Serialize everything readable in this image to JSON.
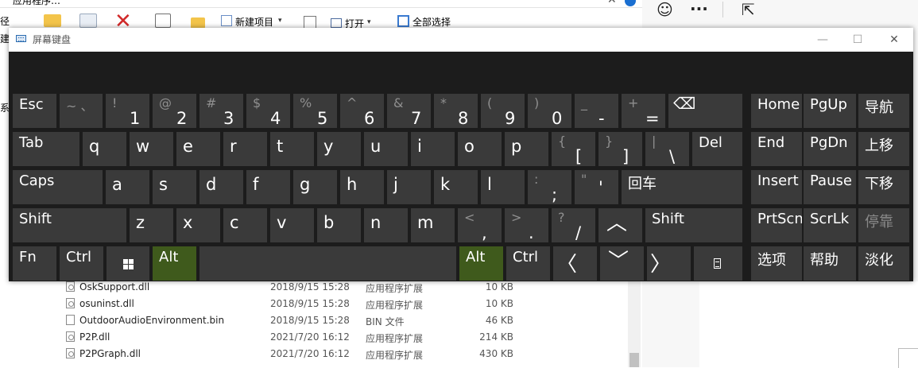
{
  "explorer": {
    "title_fragment": "应用程序…",
    "side_fragments": [
      "径",
      "建",
      "系"
    ],
    "ribbon": {
      "new_item": "新建项目",
      "open": "打开",
      "select_all": "全部选择"
    },
    "files": [
      {
        "name": "OskSupport.dll",
        "date": "2018/9/15 15:28",
        "type": "应用程序扩展",
        "size": "10 KB",
        "icon": "dll-icon"
      },
      {
        "name": "osuninst.dll",
        "date": "2018/9/15 15:28",
        "type": "应用程序扩展",
        "size": "10 KB",
        "icon": "dll-icon"
      },
      {
        "name": "OutdoorAudioEnvironment.bin",
        "date": "2018/9/15 15:28",
        "type": "BIN 文件",
        "size": "46 KB",
        "icon": "file-icon"
      },
      {
        "name": "P2P.dll",
        "date": "2021/7/20 16:12",
        "type": "应用程序扩展",
        "size": "214 KB",
        "icon": "dll-icon"
      },
      {
        "name": "P2PGraph.dll",
        "date": "2021/7/20 16:12",
        "type": "应用程序扩展",
        "size": "430 KB",
        "icon": "dll-icon"
      }
    ]
  },
  "right_toolbar": {
    "emoji_icon": "☺",
    "more_icon": "···",
    "share_icon": "⇱"
  },
  "osk": {
    "title": "屏幕键盘",
    "window_controls": {
      "minimize": "—",
      "maximize": "☐",
      "close": "✕"
    },
    "colors": {
      "key": "#3a3a3a",
      "active_key": "#3f5a1c",
      "body": "#1c1c1c"
    },
    "keys": {
      "esc": "Esc",
      "n1": {
        "up": "! ",
        "down": "1"
      },
      "tilde": {
        "up": "~ 、",
        "down": ""
      },
      "n2": {
        "up": "@",
        "down": "2"
      },
      "n3": {
        "up": "#",
        "down": "3"
      },
      "n4": {
        "up": "$",
        "down": "4"
      },
      "n5": {
        "up": "%",
        "down": "5"
      },
      "n6": {
        "up": "^",
        "down": "6"
      },
      "n7": {
        "up": "&",
        "down": "7"
      },
      "n8": {
        "up": "*",
        "down": "8"
      },
      "n9": {
        "up": "(",
        "down": "9"
      },
      "n0": {
        "up": ")",
        "down": "0"
      },
      "minus": {
        "up": "_",
        "down": "-"
      },
      "equals": {
        "up": "+",
        "down": "="
      },
      "backspace": "⌫",
      "home": "Home",
      "pgup": "PgUp",
      "nav": "导航",
      "tab": "Tab",
      "q": "q",
      "w": "w",
      "e": "e",
      "r": "r",
      "t": "t",
      "y": "y",
      "u": "u",
      "i": "i",
      "o": "o",
      "p": "p",
      "lbracket": {
        "up": "{",
        "down": "["
      },
      "rbracket": {
        "up": "}",
        "down": "]"
      },
      "backslash": {
        "up": "|",
        "down": "\\"
      },
      "del": "Del",
      "end": "End",
      "pgdn": "PgDn",
      "move_up": "上移",
      "caps": "Caps",
      "a": "a",
      "s": "s",
      "d": "d",
      "f": "f",
      "g": "g",
      "h": "h",
      "j": "j",
      "k": "k",
      "l": "l",
      "semicolon": {
        "up": ":",
        "down": ";"
      },
      "quote": {
        "up": "\"",
        "down": "'"
      },
      "enter": "回车",
      "insert": "Insert",
      "pause": "Pause",
      "move_down": "下移",
      "shift_l": "Shift",
      "z": "z",
      "x": "x",
      "c": "c",
      "v": "v",
      "b": "b",
      "n": "n",
      "m": "m",
      "comma": {
        "up": "<",
        "down": ","
      },
      "period": {
        "up": ">",
        "down": "."
      },
      "slash": {
        "up": "?",
        "down": "/"
      },
      "up_arrow": "︿",
      "shift_r": "Shift",
      "prtscn": "PrtScn",
      "scrlk": "ScrLk",
      "dock": "停靠",
      "fn": "Fn",
      "ctrl_l": "Ctrl",
      "alt_l": "Alt",
      "alt_r": "Alt",
      "ctrl_r": "Ctrl",
      "left_arrow": "〈",
      "down_arrow": "﹀",
      "right_arrow": "〉",
      "options": "选项",
      "help": "帮助",
      "fade": "淡化"
    }
  }
}
